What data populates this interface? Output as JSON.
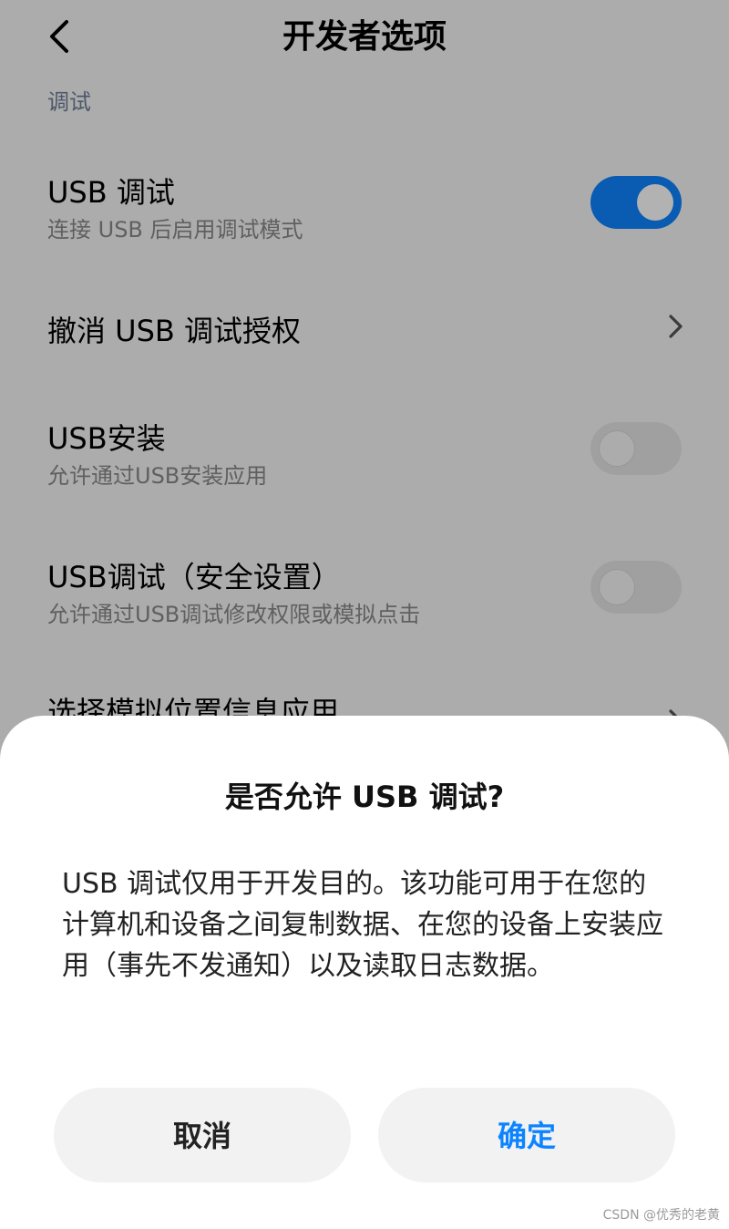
{
  "header": {
    "title": "开发者选项",
    "back_icon": "chevron-left-icon"
  },
  "section": {
    "label": "调试"
  },
  "settings": [
    {
      "title": "USB 调试",
      "subtitle": "连接 USB 后启用调试模式",
      "control": "toggle",
      "state": "on"
    },
    {
      "title": "撤消 USB 调试授权",
      "control": "chevron-right-icon"
    },
    {
      "title": "USB安装",
      "subtitle": "允许通过USB安装应用",
      "control": "toggle",
      "state": "off"
    },
    {
      "title": "USB调试（安全设置）",
      "subtitle": "允许通过USB调试修改权限或模拟点击",
      "control": "toggle",
      "state": "off"
    },
    {
      "title": "选择模拟位置信息应用",
      "control": "chevron-right-icon"
    }
  ],
  "dialog": {
    "title": "是否允许 USB 调试?",
    "body": "USB 调试仅用于开发目的。该功能可用于在您的计算机和设备之间复制数据、在您的设备上安装应用（事先不发通知）以及读取日志数据。",
    "cancel_label": "取消",
    "ok_label": "确定"
  },
  "watermark": "CSDN @优秀的老黄",
  "colors": {
    "accent": "#0d84ff",
    "section_label": "#6e7e98",
    "dim_overlay": "rgba(0,0,0,0.30)"
  }
}
